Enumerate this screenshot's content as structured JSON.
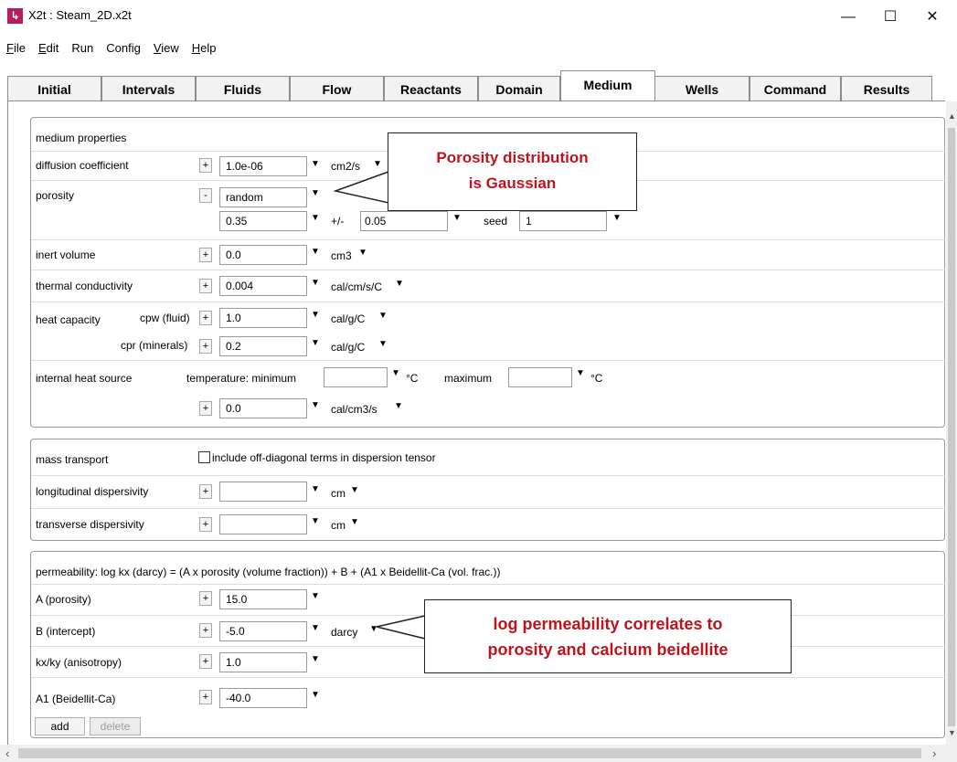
{
  "window": {
    "title": "X2t : Steam_2D.x2t",
    "app_icon_glyph": "↳",
    "controls": {
      "minimize": "—",
      "maximize": "☐",
      "close": "✕"
    }
  },
  "menu": [
    {
      "label": "File",
      "mnemonic": "F",
      "rest": "ile"
    },
    {
      "label": "Edit",
      "mnemonic": "E",
      "rest": "dit"
    },
    {
      "label": "Run",
      "mnemonic": "",
      "rest": "Run"
    },
    {
      "label": "Config",
      "mnemonic": "",
      "rest": "Config"
    },
    {
      "label": "View",
      "mnemonic": "V",
      "rest": "iew"
    },
    {
      "label": "Help",
      "mnemonic": "H",
      "rest": "elp"
    }
  ],
  "tabs": [
    "Initial",
    "Intervals",
    "Fluids",
    "Flow",
    "Reactants",
    "Domain",
    "Medium",
    "Wells",
    "Command",
    "Results"
  ],
  "active_tab": "Medium",
  "medium_properties": {
    "header": "medium properties",
    "diffusion": {
      "label": "diffusion coefficient",
      "sign": "+",
      "value": "1.0e-06",
      "unit": "cm2/s"
    },
    "porosity": {
      "label": "porosity",
      "sign": "-",
      "mode": "random",
      "mean": "0.35",
      "plusminus_label": "+/-",
      "stdev": "0.05",
      "seed_label": "seed",
      "seed": "1"
    },
    "inert_volume": {
      "label": "inert volume",
      "sign": "+",
      "value": "0.0",
      "unit": "cm3"
    },
    "thermal_conductivity": {
      "label": "thermal conductivity",
      "sign": "+",
      "value": "0.004",
      "unit": "cal/cm/s/C"
    },
    "heat_capacity": {
      "label": "heat capacity",
      "cpw": {
        "label": "cpw (fluid)",
        "sign": "+",
        "value": "1.0",
        "unit": "cal/g/C"
      },
      "cpr": {
        "label": "cpr (minerals)",
        "sign": "+",
        "value": "0.2",
        "unit": "cal/g/C"
      }
    },
    "internal_heat_source": {
      "label": "internal heat source",
      "temp_label": "temperature:  minimum",
      "min_value": "",
      "min_unit": "°C",
      "max_label": "maximum",
      "max_value": "",
      "max_unit": "°C",
      "sign": "+",
      "value": "0.0",
      "unit": "cal/cm3/s"
    }
  },
  "mass_transport": {
    "header": "mass transport",
    "checkbox_label": "include off-diagonal terms in dispersion tensor",
    "checked": false,
    "longitudinal": {
      "label": "longitudinal dispersivity",
      "sign": "+",
      "value": "",
      "unit": "cm"
    },
    "transverse": {
      "label": "transverse dispersivity",
      "sign": "+",
      "value": "",
      "unit": "cm"
    }
  },
  "permeability": {
    "header": "permeability: log kx (darcy) = (A x porosity (volume fraction)) + B + (A1 x Beidellit-Ca (vol. frac.))",
    "rows": [
      {
        "label": "A (porosity)",
        "sign": "+",
        "value": "15.0",
        "unit": ""
      },
      {
        "label": "B (intercept)",
        "sign": "+",
        "value": "-5.0",
        "unit": "darcy"
      },
      {
        "label": "kx/ky (anisotropy)",
        "sign": "+",
        "value": "1.0",
        "unit": ""
      },
      {
        "label": "A1 (Beidellit-Ca)",
        "sign": "+",
        "value": "-40.0",
        "unit": ""
      }
    ],
    "add_label": "add",
    "delete_label": "delete"
  },
  "callouts": {
    "porosity_line1": "Porosity distribution",
    "porosity_line2": "is Gaussian",
    "permeability_line1": "log permeability correlates to",
    "permeability_line2": "porosity and calcium beidellite"
  },
  "colors": {
    "callout_text": "#c0141c",
    "app_icon": "#b71c5c"
  }
}
